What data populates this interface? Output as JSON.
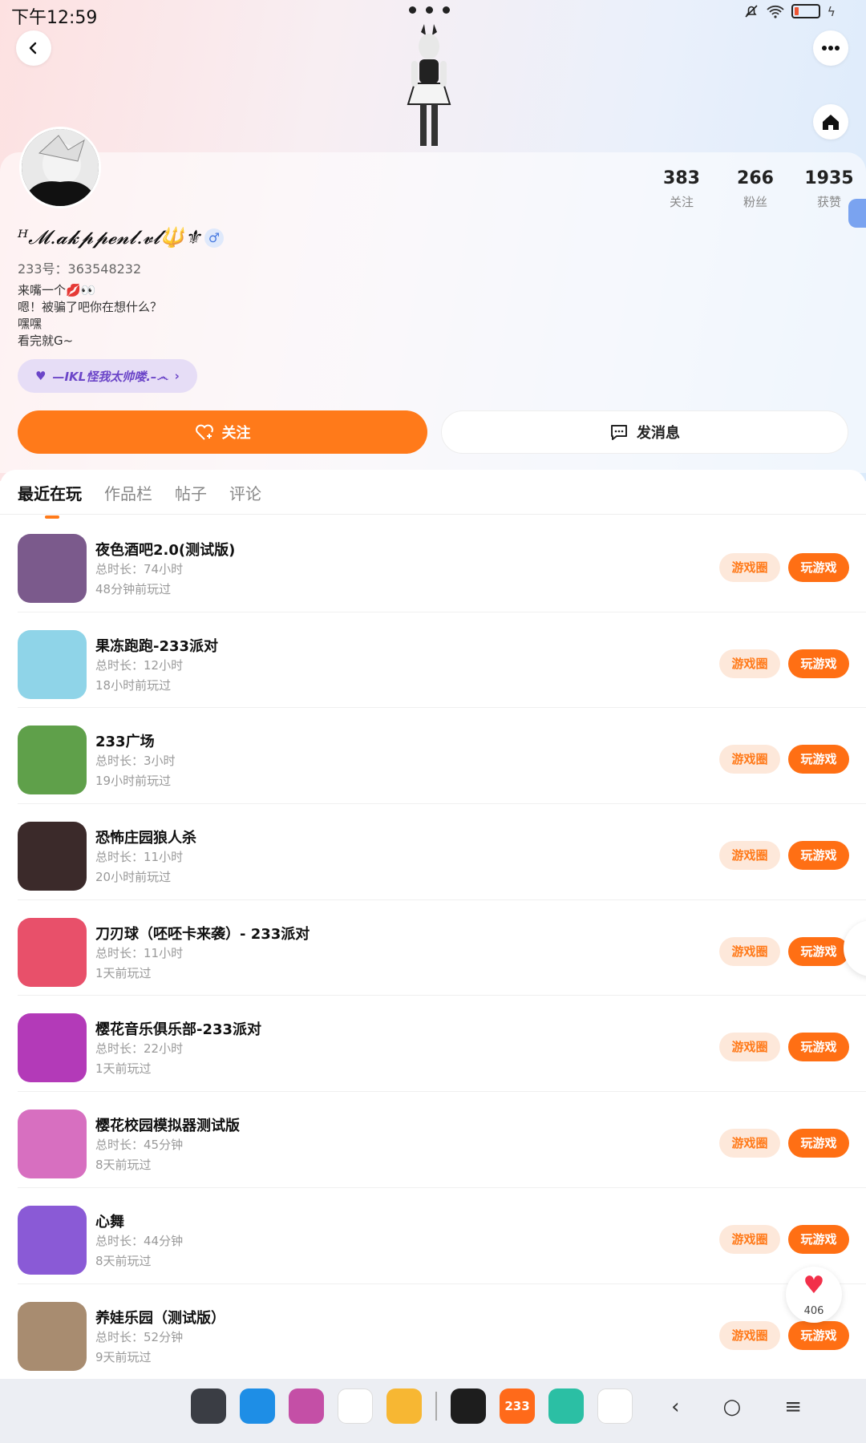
{
  "status_bar": {
    "time": "下午12:59"
  },
  "profile": {
    "username": "ᴴ𝓜.𝓪𝓴𝓹𝓹𝓮𝓷𝓵.𝓿𝓵🔱⚜",
    "gender_symbol": "♂",
    "uid": "233号：363548232",
    "bio_lines": [
      "来嘴一个💋👀",
      "嗯！被骗了吧你在想什么？",
      "嘿嘿",
      "看完就G~"
    ],
    "pill_label": "—IKL怪我太帅喽.–෴",
    "stats": [
      {
        "value": "383",
        "label": "关注"
      },
      {
        "value": "266",
        "label": "粉丝"
      },
      {
        "value": "1935",
        "label": "获赞"
      }
    ],
    "follow_label": "关注",
    "message_label": "发消息"
  },
  "tabs": [
    "最近在玩",
    "作品栏",
    "帖子",
    "评论"
  ],
  "games": [
    {
      "title": "夜色酒吧2.0(测试版)",
      "duration": "总时长：74小时",
      "ago": "48分钟前玩过",
      "color": "#7b5a8c"
    },
    {
      "title": "果冻跑跑-233派对",
      "duration": "总时长：12小时",
      "ago": "18小时前玩过",
      "color": "#8fd4e8"
    },
    {
      "title": "233广场",
      "duration": "总时长：3小时",
      "ago": "19小时前玩过",
      "color": "#5fa04a"
    },
    {
      "title": "恐怖庄园狼人杀",
      "duration": "总时长：11小时",
      "ago": "20小时前玩过",
      "color": "#3b2a2a"
    },
    {
      "title": "刀刃球（呸呸卡来袭）- 233派对",
      "duration": "总时长：11小时",
      "ago": "1天前玩过",
      "color": "#e8506a"
    },
    {
      "title": "樱花音乐俱乐部-233派对",
      "duration": "总时长：22小时",
      "ago": "1天前玩过",
      "color": "#b33ab8"
    },
    {
      "title": "樱花校园模拟器测试版",
      "duration": "总时长：45分钟",
      "ago": "8天前玩过",
      "color": "#d76fc0"
    },
    {
      "title": "心舞",
      "duration": "总时长：44分钟",
      "ago": "8天前玩过",
      "color": "#8a5ad6"
    },
    {
      "title": "养娃乐园（测试版）",
      "duration": "总时长：52分钟",
      "ago": "9天前玩过",
      "color": "#a88c70"
    }
  ],
  "game_circle_label": "游戏圈",
  "play_label": "玩游戏",
  "like_count": "406",
  "dock_apps": [
    {
      "name": "clock-app-icon",
      "color": "#3a3d44"
    },
    {
      "name": "browser-app-icon",
      "color": "#1e8ee6"
    },
    {
      "name": "gallery-app-icon",
      "color": "#c44fa6"
    },
    {
      "name": "camera-app-icon",
      "color": "#ffffff"
    },
    {
      "name": "notes-app-icon",
      "color": "#f7b733"
    },
    {
      "name": "screen-recorder-app-icon",
      "color": "#1d1d1d"
    },
    {
      "name": "233-app-icon",
      "color": "#ff6a1a",
      "text": "233"
    },
    {
      "name": "security-app-icon",
      "color": "#2bbfa4"
    },
    {
      "name": "apps-grid-icon",
      "color": "#ffffff"
    }
  ]
}
